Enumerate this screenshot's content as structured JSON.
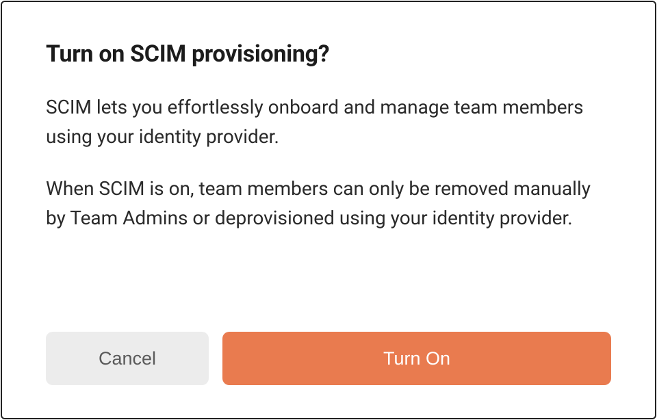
{
  "dialog": {
    "title": "Turn on SCIM provisioning?",
    "paragraph1": "SCIM lets you effortlessly onboard and manage team members using your identity provider.",
    "paragraph2": "When SCIM is on, team members can only be removed manually by Team Admins or deprovisioned using your identity provider.",
    "actions": {
      "cancel_label": "Cancel",
      "confirm_label": "Turn On"
    }
  },
  "colors": {
    "primary": "#e97b4f",
    "cancel_bg": "#ececec"
  }
}
